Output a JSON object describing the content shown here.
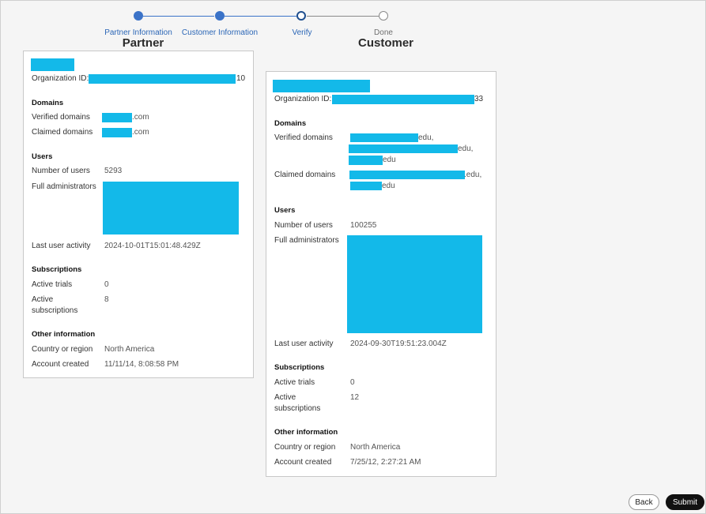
{
  "stepper": {
    "steps": [
      {
        "label": "Partner Information",
        "state": "done"
      },
      {
        "label": "Customer Information",
        "state": "done"
      },
      {
        "label": "Verify",
        "state": "current"
      },
      {
        "label": "Done",
        "state": "todo"
      }
    ]
  },
  "partner": {
    "header": "Partner",
    "org_id_label": "Organization ID:",
    "org_id_suffix": "10",
    "domains_title": "Domains",
    "verified_domains_label": "Verified domains",
    "verified_domains_value": ".com",
    "claimed_domains_label": "Claimed domains",
    "claimed_domains_value": ".com",
    "users_title": "Users",
    "number_of_users_label": "Number of users",
    "number_of_users_value": "5293",
    "full_admins_label": "Full administrators",
    "last_activity_label": "Last user activity",
    "last_activity_value": "2024-10-01T15:01:48.429Z",
    "subs_title": "Subscriptions",
    "active_trials_label": "Active trials",
    "active_trials_value": "0",
    "active_subs_label_1": "Active",
    "active_subs_label_2": "subscriptions",
    "active_subs_value": "8",
    "other_title": "Other information",
    "country_label": "Country or region",
    "country_value": "North America",
    "created_label": "Account created",
    "created_value": "11/11/14, 8:08:58 PM"
  },
  "customer": {
    "header": "Customer",
    "org_id_label": "Organization ID:",
    "org_id_suffix": "33",
    "domains_title": "Domains",
    "verified_domains_label": "Verified domains",
    "verified_domains_values": [
      "edu,",
      "edu,",
      "edu"
    ],
    "claimed_domains_label": "Claimed domains",
    "claimed_domains_values": [
      ".edu,",
      "edu"
    ],
    "users_title": "Users",
    "number_of_users_label": "Number of users",
    "number_of_users_value": "100255",
    "full_admins_label": "Full administrators",
    "last_activity_label": "Last user activity",
    "last_activity_value": "2024-09-30T19:51:23.004Z",
    "subs_title": "Subscriptions",
    "active_trials_label": "Active trials",
    "active_trials_value": "0",
    "active_subs_label_1": "Active",
    "active_subs_label_2": "subscriptions",
    "active_subs_value": "12",
    "other_title": "Other information",
    "country_label": "Country or region",
    "country_value": "North America",
    "created_label": "Account created",
    "created_value": "7/25/12, 2:27:21 AM"
  },
  "footer": {
    "back_label": "Back",
    "submit_label": "Submit"
  },
  "colors": {
    "accent": "#3b73c8",
    "redaction": "#13b9e9"
  }
}
